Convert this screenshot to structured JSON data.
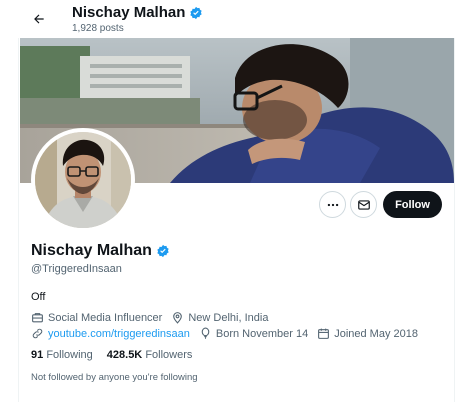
{
  "header": {
    "name": "Nischay Malhan",
    "posts": "1,928 posts"
  },
  "actions": {
    "follow_label": "Follow"
  },
  "profile": {
    "name": "Nischay Malhan",
    "handle": "@TriggeredInsaan",
    "bio": "Off",
    "category": "Social Media Influencer",
    "location": "New Delhi, India",
    "website": "youtube.com/triggeredinsaan",
    "birthday": "Born November 14",
    "joined": "Joined May 2018"
  },
  "stats": {
    "following_count": "91",
    "following_label": "Following",
    "followers_count": "428.5K",
    "followers_label": "Followers"
  },
  "note": "Not followed by anyone you're following",
  "colors": {
    "verified": "#1d9bf0",
    "link": "#1d9bf0",
    "follow_button": "#0f1419"
  }
}
